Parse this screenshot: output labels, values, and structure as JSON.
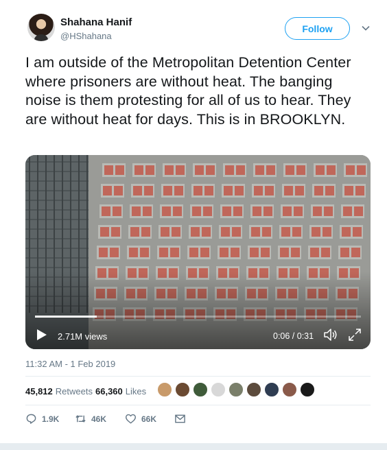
{
  "author": {
    "name": "Shahana Hanif",
    "handle": "@HShahana"
  },
  "follow_label": "Follow",
  "tweet_text": "I am outside of the Metropolitan Detention Center where prisoners are without heat. The banging noise is them protesting for all of us to hear. They are without heat for days. This is in BROOKLYN.",
  "media": {
    "views": "2.71M views",
    "time": "0:06 / 0:31",
    "progress": 0.19
  },
  "timestamp": "11:32 AM - 1 Feb 2019",
  "stats": {
    "retweets_count": "45,812",
    "retweets_label": "Retweets",
    "likes_count": "66,360",
    "likes_label": "Likes"
  },
  "actions": {
    "reply_count": "1.9K",
    "retweet_count": "46K",
    "like_count": "66K"
  },
  "colors": {
    "accent": "#1da1f2",
    "secondary_text": "#657786",
    "divider": "#e6ecf0"
  },
  "icons": [
    "chevron-down-icon",
    "play-icon",
    "volume-icon",
    "fullscreen-icon",
    "reply-icon",
    "retweet-icon",
    "like-icon",
    "message-icon"
  ]
}
